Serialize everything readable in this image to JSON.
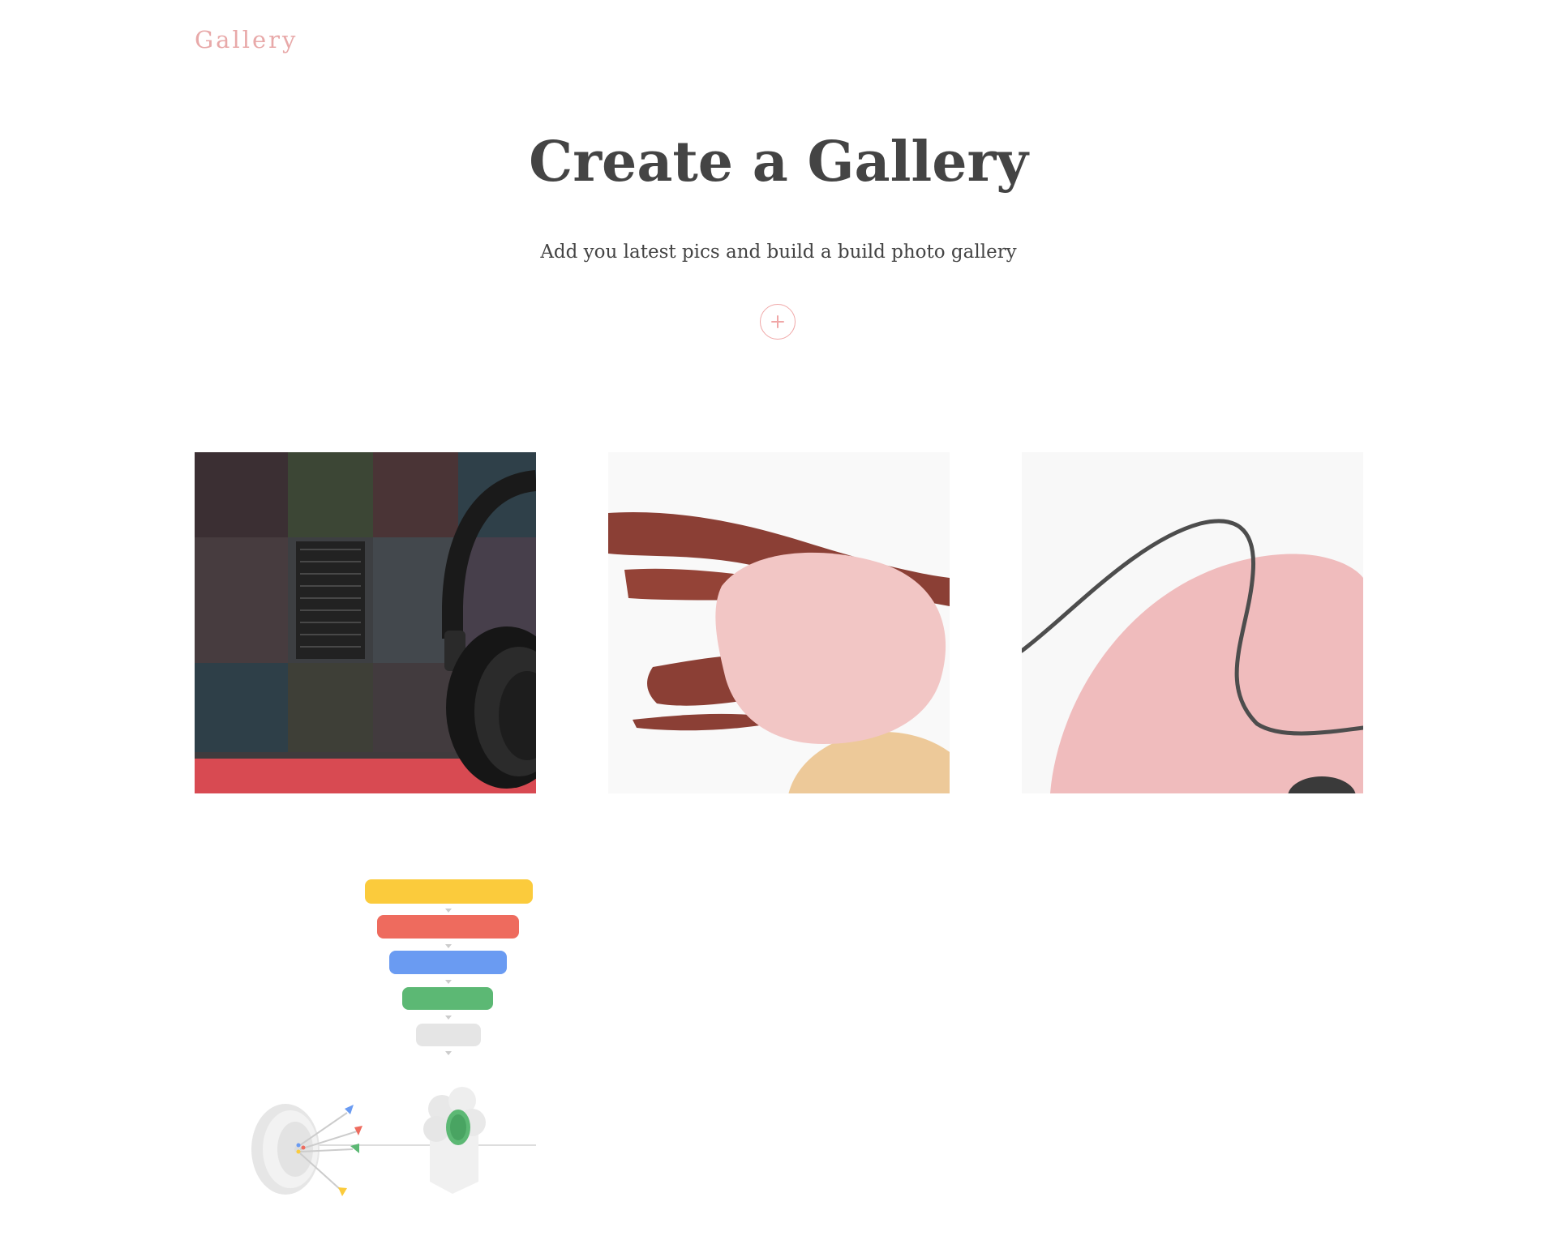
{
  "header": {
    "brand": "Gallery"
  },
  "hero": {
    "title": "Create a Gallery",
    "subtitle": "Add you latest pics and build a build photo gallery",
    "add_icon": "plus-icon"
  },
  "gallery": {
    "items": [
      {
        "name": "headphones-photo"
      },
      {
        "name": "abstract-brush-strokes"
      },
      {
        "name": "abstract-pink-shape-line"
      },
      {
        "name": "marketing-funnel-illustration"
      }
    ]
  },
  "colors": {
    "accent": "#e8a9a9",
    "text": "#444444",
    "funnel": [
      "#fbcb3c",
      "#ee6b5e",
      "#6a9bf2",
      "#5cb874",
      "#e5e5e5"
    ]
  }
}
